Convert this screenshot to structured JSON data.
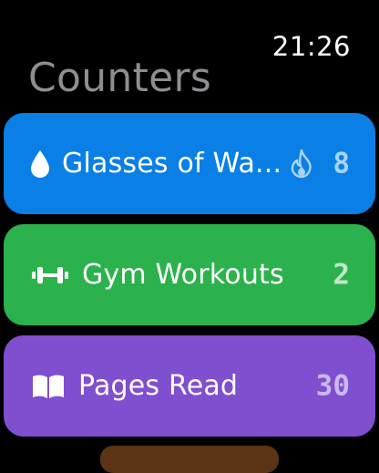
{
  "status": {
    "time": "21:26"
  },
  "header": {
    "title": "Counters"
  },
  "counters": [
    {
      "label": "Glasses of Wa...",
      "count": "8",
      "icon": "water-drop-icon",
      "streak_icon": "flame-icon",
      "color": "#0a7fe6"
    },
    {
      "label": "Gym Workouts",
      "count": "2",
      "icon": "dumbbell-icon",
      "color": "#2cb24c"
    },
    {
      "label": "Pages Read",
      "count": "30",
      "icon": "book-icon",
      "color": "#7f4fd0"
    }
  ],
  "colors": {
    "background": "#000000",
    "title": "#8e8e93",
    "next_card": "#5a3414"
  }
}
